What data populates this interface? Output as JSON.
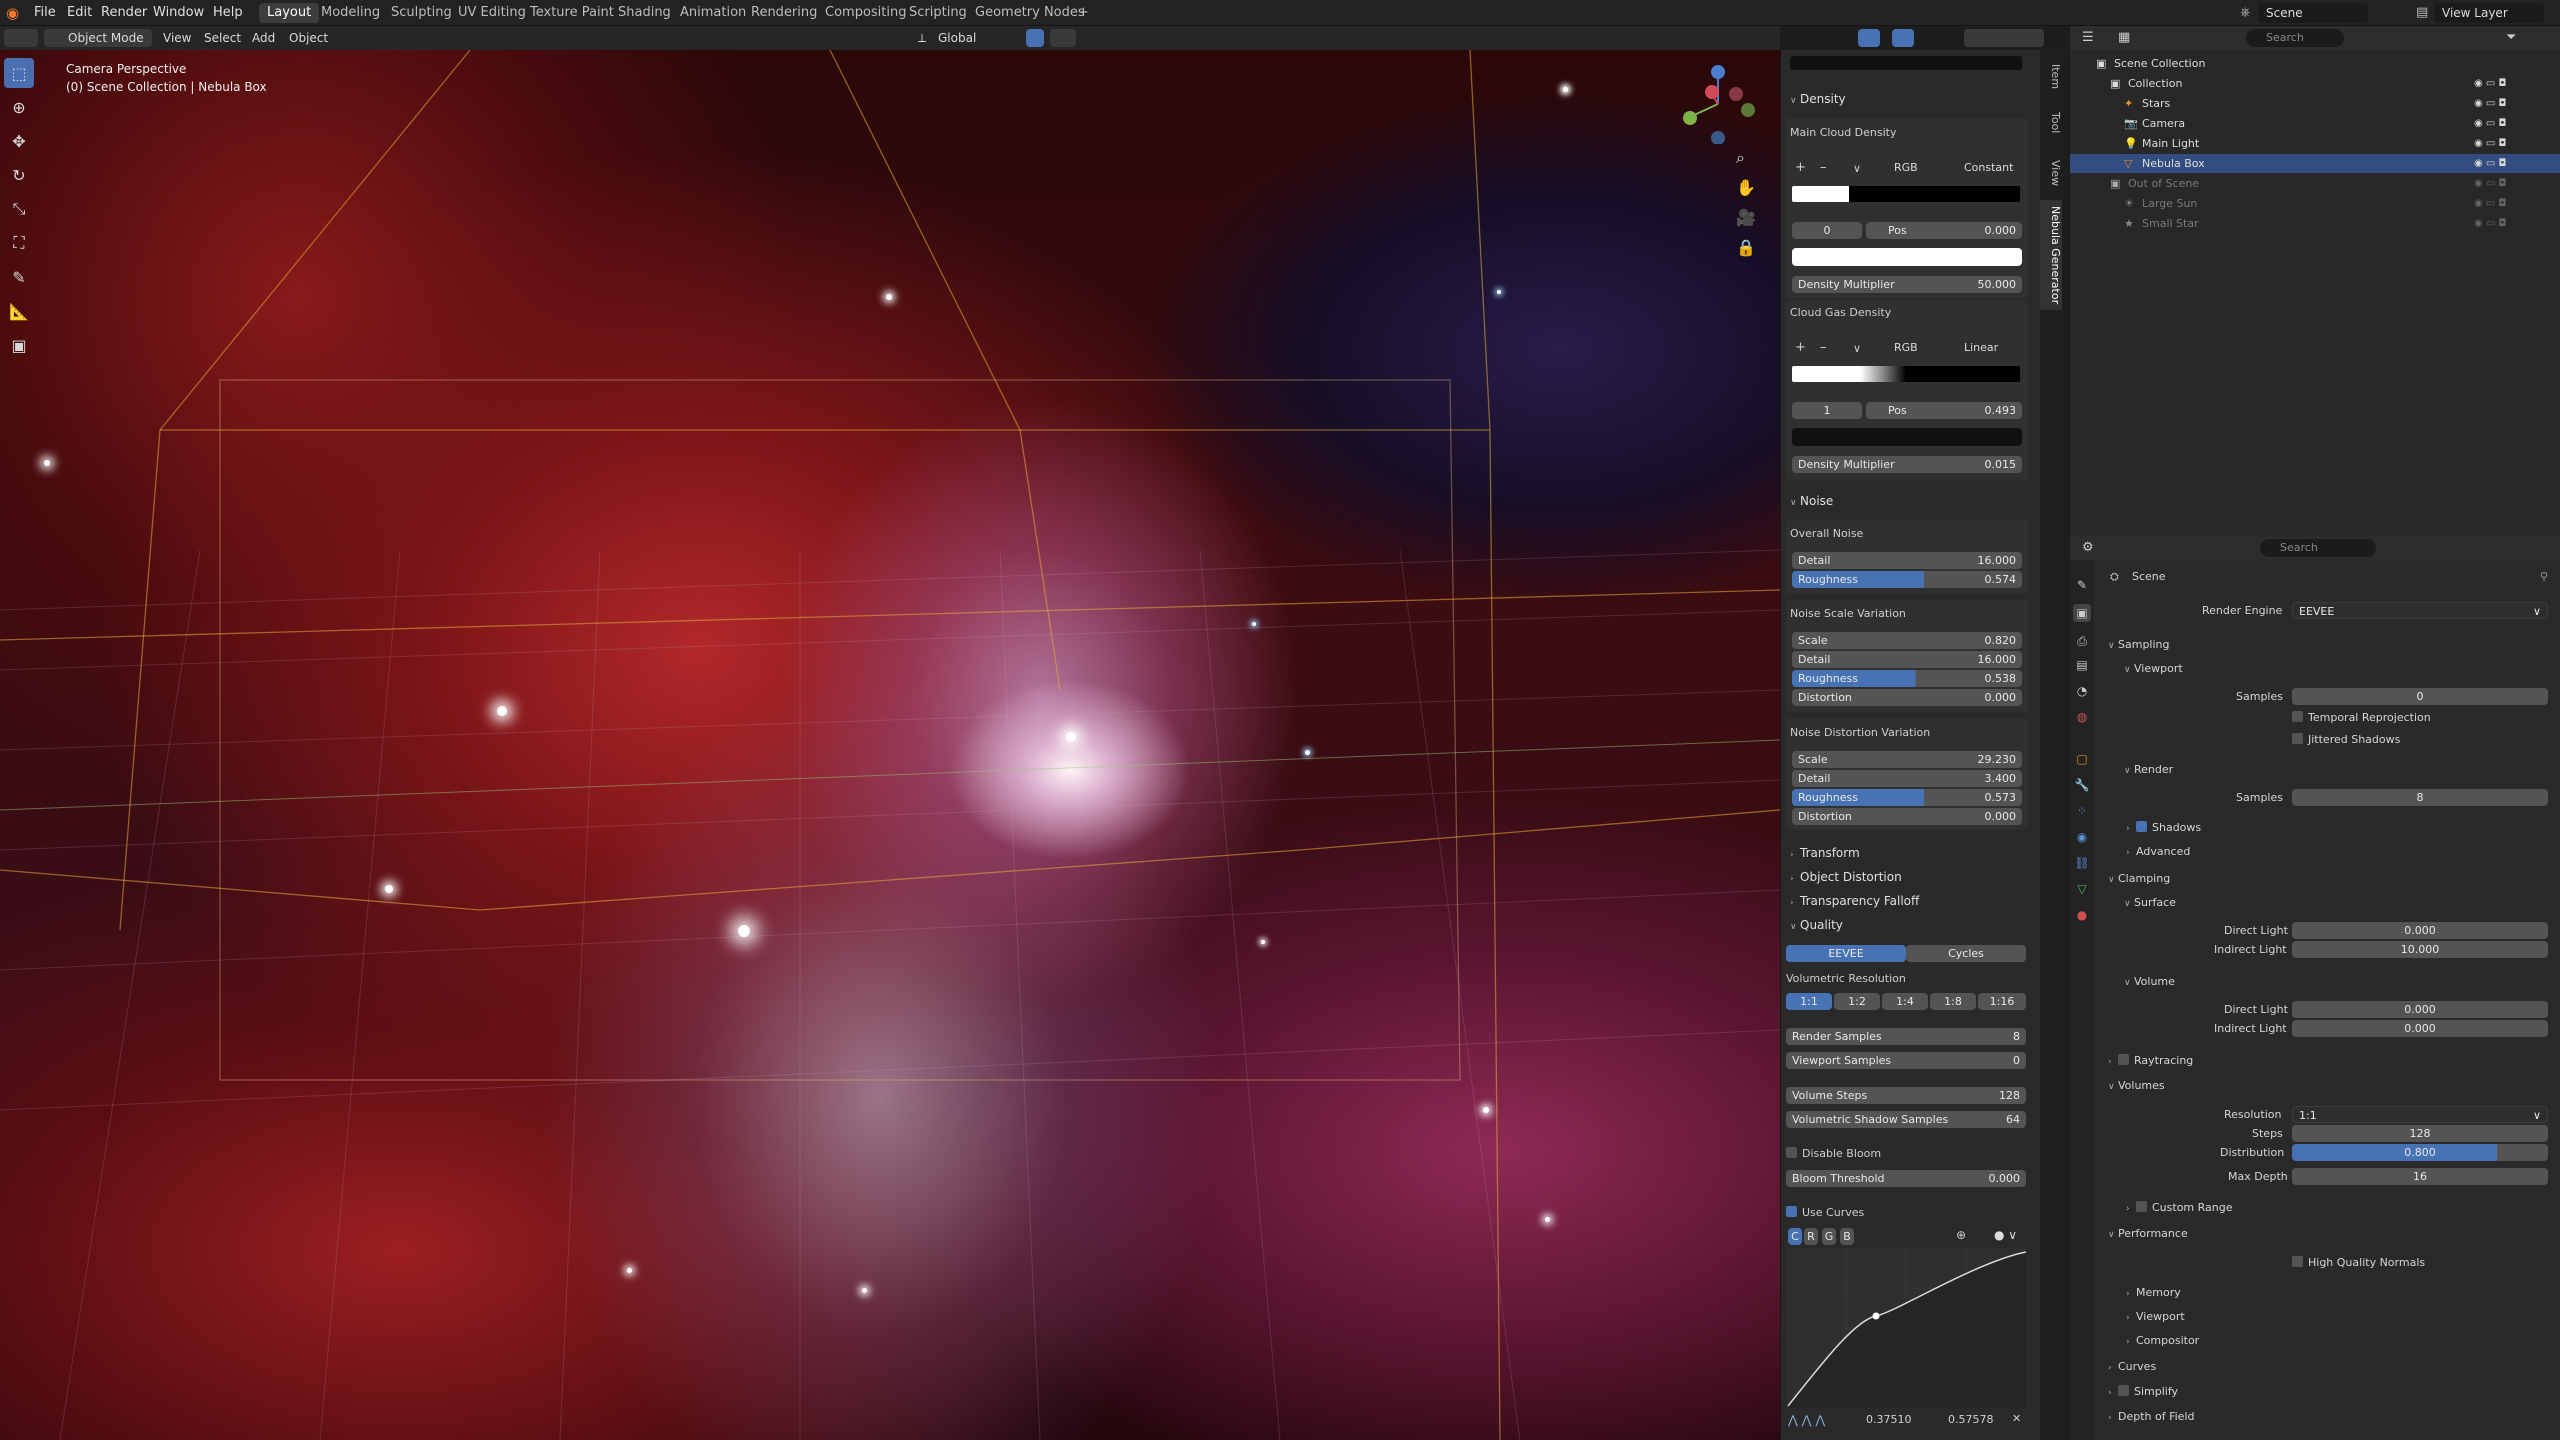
{
  "topbar": {
    "menus": [
      "File",
      "Edit",
      "Render",
      "Window",
      "Help"
    ],
    "workspaces": [
      "Layout",
      "Modeling",
      "Sculpting",
      "UV Editing",
      "Texture Paint",
      "Shading",
      "Animation",
      "Rendering",
      "Compositing",
      "Scripting",
      "Geometry Nodes"
    ],
    "add": "+",
    "scene": "Scene",
    "view_layer": "View Layer"
  },
  "vp_header": {
    "mode": "Object Mode",
    "menus": [
      "View",
      "Select",
      "Add",
      "Object"
    ],
    "orientation": "Global"
  },
  "viewport": {
    "title": "Camera Perspective",
    "subtitle": "(0) Scene Collection | Nebula Box"
  },
  "sidebar_tabs": [
    "Item",
    "Tool",
    "View",
    "Nebula Generator"
  ],
  "density": {
    "title": "Density",
    "main": {
      "label": "Main Cloud Density",
      "color_mode": "RGB",
      "interp": "Constant",
      "index": "0",
      "pos_label": "Pos",
      "pos": "0.000",
      "mult_label": "Density Multiplier",
      "mult": "50.000"
    },
    "gas": {
      "label": "Cloud Gas Density",
      "color_mode": "RGB",
      "interp": "Linear",
      "index": "1",
      "pos_label": "Pos",
      "pos": "0.493",
      "mult_label": "Density Multiplier",
      "mult": "0.015"
    }
  },
  "noise": {
    "title": "Noise",
    "overall": {
      "label": "Overall Noise",
      "detail_label": "Detail",
      "detail": "16.000",
      "rough_label": "Roughness",
      "rough": "0.574"
    },
    "scale_var": {
      "label": "Noise Scale Variation",
      "scale_label": "Scale",
      "scale": "0.820",
      "detail_label": "Detail",
      "detail": "16.000",
      "rough_label": "Roughness",
      "rough": "0.538",
      "dist_label": "Distortion",
      "dist": "0.000"
    },
    "dist_var": {
      "label": "Noise Distortion Variation",
      "scale_label": "Scale",
      "scale": "29.230",
      "detail_label": "Detail",
      "detail": "3.400",
      "rough_label": "Roughness",
      "rough": "0.573",
      "dist_label": "Distortion",
      "dist": "0.000"
    }
  },
  "collapsed": [
    "Transform",
    "Object Distortion",
    "Transparency Falloff"
  ],
  "quality": {
    "title": "Quality",
    "engines": [
      "EEVEE",
      "Cycles"
    ],
    "volres_label": "Volumetric Resolution",
    "volres": [
      "1:1",
      "1:2",
      "1:4",
      "1:8",
      "1:16"
    ],
    "render_samples_label": "Render Samples",
    "render_samples": "8",
    "viewport_samples_label": "Viewport Samples",
    "viewport_samples": "0",
    "vol_steps_label": "Volume Steps",
    "vol_steps": "128",
    "shadow_label": "Volumetric Shadow Samples",
    "shadow": "64",
    "disable_bloom": "Disable Bloom",
    "bloom_label": "Bloom Threshold",
    "bloom": "0.000",
    "use_curves": "Use Curves",
    "channels": [
      "C",
      "R",
      "G",
      "B"
    ],
    "curve_x": "0.37510",
    "curve_y": "0.57578"
  },
  "outliner": {
    "search": "Search",
    "rows": [
      {
        "name": "Scene Collection",
        "indent": 0
      },
      {
        "name": "Collection",
        "indent": 1
      },
      {
        "name": "Stars",
        "indent": 2
      },
      {
        "name": "Camera",
        "indent": 2
      },
      {
        "name": "Main Light",
        "indent": 2
      },
      {
        "name": "Nebula Box",
        "indent": 2
      },
      {
        "name": "Out of Scene",
        "indent": 1
      },
      {
        "name": "Large Sun",
        "indent": 2
      },
      {
        "name": "Small Star",
        "indent": 2
      }
    ]
  },
  "props": {
    "search": "Search",
    "context": "Scene",
    "render_engine_label": "Render Engine",
    "render_engine": "EEVEE",
    "sampling": "Sampling",
    "viewport": "Viewport",
    "samples_label": "Samples",
    "vp_samples": "0",
    "temporal": "Temporal Reprojection",
    "jittered": "Jittered Shadows",
    "render": "Render",
    "r_samples": "8",
    "shadows": "Shadows",
    "advanced": "Advanced",
    "clamping": "Clamping",
    "surface": "Surface",
    "direct": "Direct Light",
    "indirect": "Indirect Light",
    "s_direct": "0.000",
    "s_indirect": "10.000",
    "volume": "Volume",
    "v_direct": "0.000",
    "v_indirect": "0.000",
    "raytracing": "Raytracing",
    "volumes": "Volumes",
    "resolution_label": "Resolution",
    "resolution": "1:1",
    "steps_label": "Steps",
    "steps": "128",
    "distribution_label": "Distribution",
    "distribution": "0.800",
    "maxdepth_label": "Max Depth",
    "maxdepth": "16",
    "custom_range": "Custom Range",
    "performance": "Performance",
    "hq_normals": "High Quality Normals",
    "memory": "Memory",
    "p_viewport": "Viewport",
    "compositor": "Compositor",
    "curves": "Curves",
    "simplify": "Simplify",
    "dof": "Depth of Field"
  }
}
